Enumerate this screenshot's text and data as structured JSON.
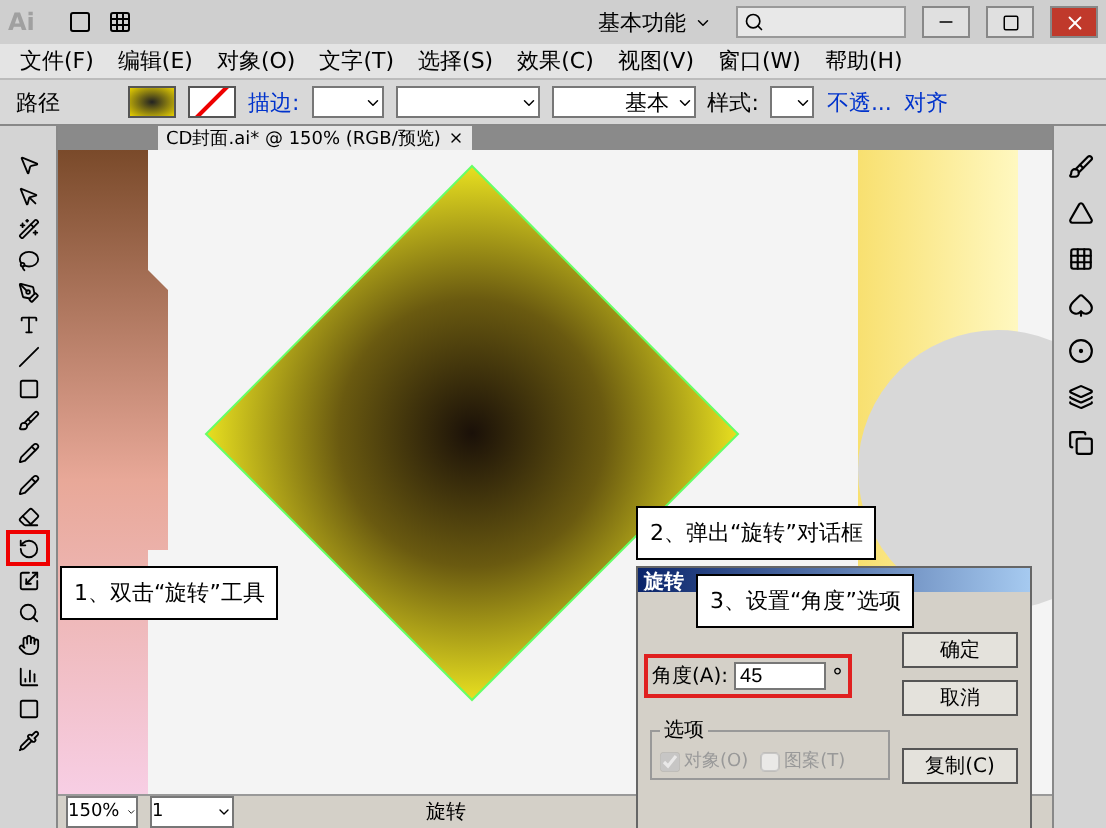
{
  "app": {
    "logo": "Ai",
    "workspace": "基本功能"
  },
  "menu": [
    {
      "label": "文件(F)"
    },
    {
      "label": "编辑(E)"
    },
    {
      "label": "对象(O)"
    },
    {
      "label": "文字(T)"
    },
    {
      "label": "选择(S)"
    },
    {
      "label": "效果(C)"
    },
    {
      "label": "视图(V)"
    },
    {
      "label": "窗口(W)"
    },
    {
      "label": "帮助(H)"
    }
  ],
  "control_bar": {
    "object": "路径",
    "stroke_label": "描边:",
    "stroke_profile": "基本",
    "style_label": "样式:",
    "opacity_link": "不透...",
    "align_link": "对齐"
  },
  "document_tab": {
    "title": "CD封面.ai* @ 150% (RGB/预览)"
  },
  "dialog": {
    "title": "旋转",
    "angle_label": "角度(A):",
    "angle_value": "45",
    "unit": "°",
    "buttons": [
      "确定",
      "取消",
      "复制(C)"
    ],
    "options_title": "选项",
    "options": [
      {
        "label": "对象(O)",
        "checked": true,
        "disabled": true
      },
      {
        "label": "图案(T)",
        "checked": false,
        "disabled": true
      }
    ]
  },
  "callouts": [
    {
      "text": "1、双击“旋转”工具"
    },
    {
      "text": "2、弹出“旋转”对话框"
    },
    {
      "text": "3、设置“角度”选项"
    }
  ],
  "status_bar": {
    "zoom": "150%",
    "page": "1",
    "tool": "旋转"
  }
}
